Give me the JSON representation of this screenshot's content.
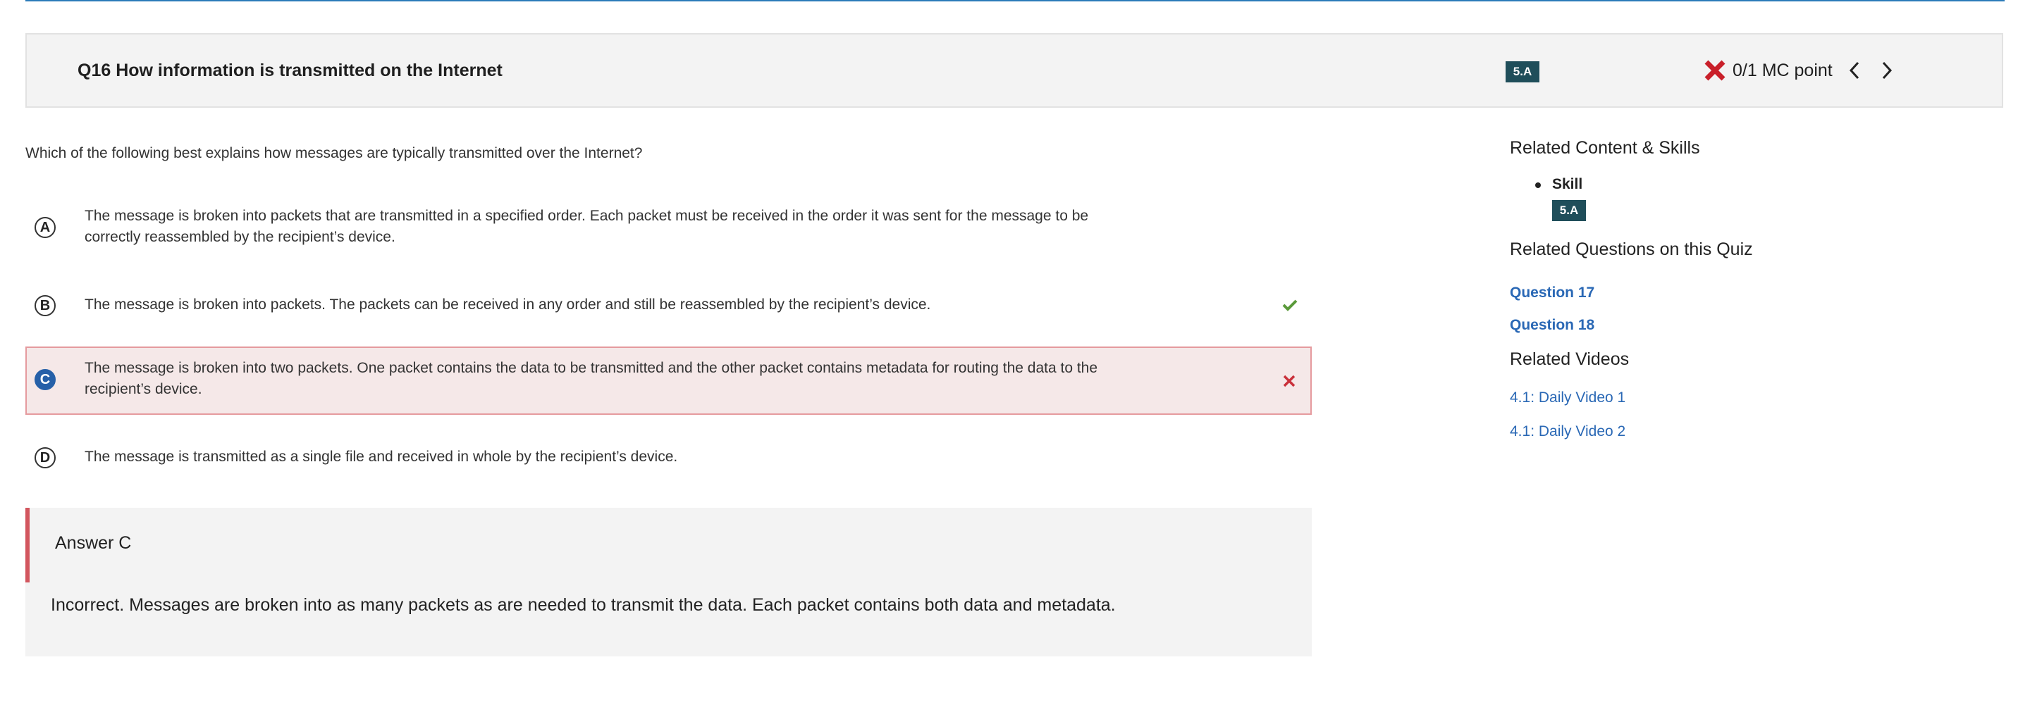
{
  "header": {
    "title": "Q16 How information is transmitted on the Internet",
    "skill_badge": "5.A",
    "score": "0/1 MC point",
    "score_icon": "x-icon",
    "prev_icon": "chevron-left-icon",
    "next_icon": "chevron-right-icon"
  },
  "question": {
    "prompt": "Which of the following best explains how messages are typically transmitted over the Internet?",
    "options": [
      {
        "letter": "A",
        "text": "The message is broken into packets that are transmitted in a specified order. Each packet must be received in the order it was sent for the message to be correctly reassembled by the recipient’s device.",
        "state": "unselected"
      },
      {
        "letter": "B",
        "text": "The message is broken into packets. The packets can be received in any order and still be reassembled by the recipient’s device.",
        "state": "correct",
        "mark_icon": "check-icon"
      },
      {
        "letter": "C",
        "text": "The message is broken into two packets. One packet contains the data to be transmitted and the other packet contains metadata for routing the data to the recipient’s device.",
        "state": "selected-incorrect",
        "mark_icon": "x-icon"
      },
      {
        "letter": "D",
        "text": "The message is transmitted as a single file and received in whole by the recipient’s device.",
        "state": "unselected"
      }
    ]
  },
  "answer": {
    "title": "Answer C",
    "explanation": "Incorrect. Messages are broken into as many packets as are needed to transmit the data. Each packet contains both data and metadata."
  },
  "sidebar": {
    "related_heading": "Related Content & Skills",
    "skill_label": "Skill",
    "skill_badge": "5.A",
    "questions_heading": "Related Questions on this Quiz",
    "questions": [
      "Question 17",
      "Question 18"
    ],
    "videos_heading": "Related Videos",
    "videos": [
      "4.1: Daily Video 1",
      "4.1: Daily Video 2"
    ]
  },
  "colors": {
    "accent_blue": "#2660a8",
    "link_blue": "#2a68b5",
    "badge_bg": "#1f4e5a",
    "incorrect_red": "#d2565e",
    "correct_green": "#5a9a3a",
    "selected_incorrect_bg": "#f5e8e8"
  }
}
